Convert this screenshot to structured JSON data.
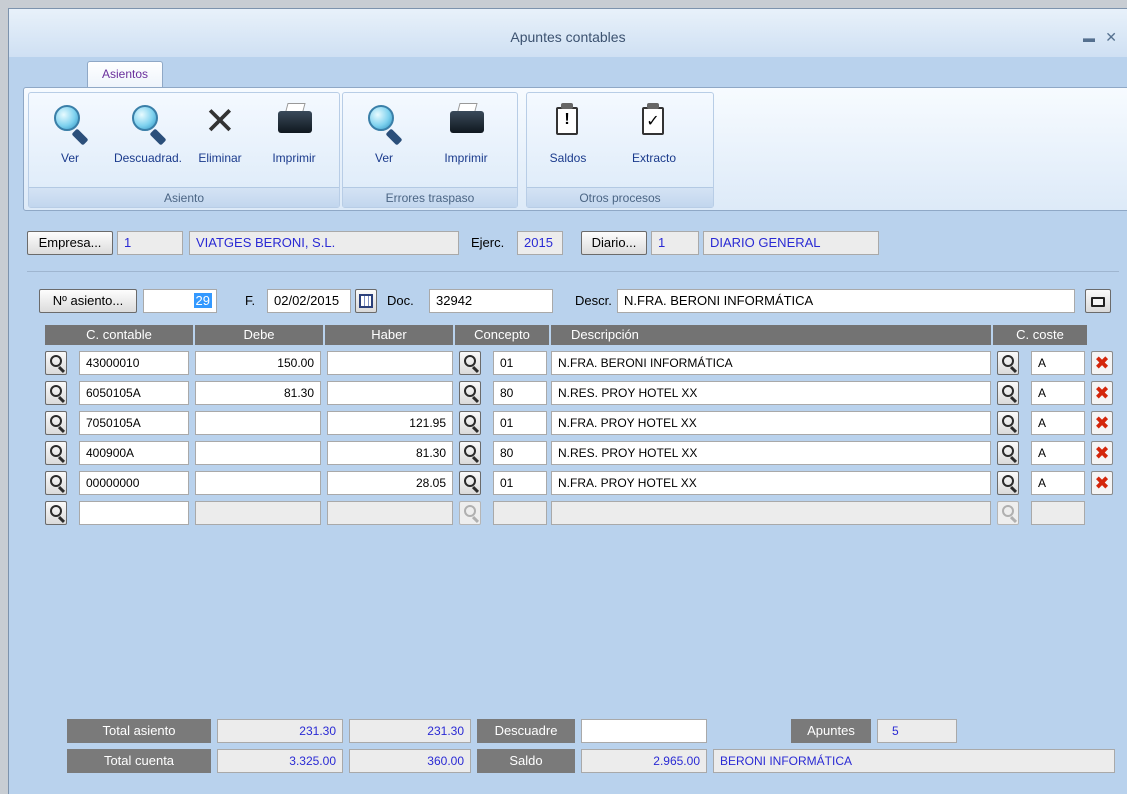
{
  "window": {
    "title": "Apuntes contables"
  },
  "tabs": [
    {
      "label": "Asientos"
    }
  ],
  "ribbon": {
    "groups": [
      {
        "label": "Asiento",
        "buttons": [
          {
            "label": "Ver",
            "icon": "magnifier-icon"
          },
          {
            "label": "Descuadrad.",
            "icon": "magnifier-icon"
          },
          {
            "label": "Eliminar",
            "icon": "delete-x-icon"
          },
          {
            "label": "Imprimir",
            "icon": "printer-icon"
          }
        ]
      },
      {
        "label": "Errores traspaso",
        "buttons": [
          {
            "label": "Ver",
            "icon": "magnifier-icon"
          },
          {
            "label": "Imprimir",
            "icon": "printer-icon"
          }
        ]
      },
      {
        "label": "Otros procesos",
        "buttons": [
          {
            "label": "Saldos",
            "icon": "clipboard-alert-icon"
          },
          {
            "label": "Extracto",
            "icon": "clipboard-check-icon"
          }
        ]
      }
    ]
  },
  "header": {
    "empresa_button": "Empresa...",
    "empresa_code": "1",
    "empresa_name": "VIATGES BERONI, S.L.",
    "ejerc_label": "Ejerc.",
    "ejerc_value": "2015",
    "diario_button": "Diario...",
    "diario_code": "1",
    "diario_name": "DIARIO GENERAL"
  },
  "asiento": {
    "button": "Nº asiento...",
    "number": "29",
    "fecha_label": "F.",
    "fecha": "02/02/2015",
    "doc_label": "Doc.",
    "doc": "32942",
    "descr_label": "Descr.",
    "descr": "N.FRA. BERONI INFORMÁTICA"
  },
  "grid": {
    "columns": [
      "C. contable",
      "Debe",
      "Haber",
      "Concepto",
      "Descripción",
      "C. coste"
    ],
    "rows": [
      {
        "cuenta": "43000010",
        "debe": "150.00",
        "haber": "",
        "concepto": "01",
        "descripcion": "N.FRA. BERONI INFORMÁTICA",
        "coste": "A"
      },
      {
        "cuenta": "6050105A",
        "debe": "81.30",
        "haber": "",
        "concepto": "80",
        "descripcion": "N.RES. PROY HOTEL XX",
        "coste": "A"
      },
      {
        "cuenta": "7050105A",
        "debe": "",
        "haber": "121.95",
        "concepto": "01",
        "descripcion": "N.FRA. PROY HOTEL XX",
        "coste": "A"
      },
      {
        "cuenta": "400900A",
        "debe": "",
        "haber": "81.30",
        "concepto": "80",
        "descripcion": "N.RES. PROY HOTEL XX",
        "coste": "A"
      },
      {
        "cuenta": "00000000",
        "debe": "",
        "haber": "28.05",
        "concepto": "01",
        "descripcion": "N.FRA. PROY HOTEL XX",
        "coste": "A"
      }
    ]
  },
  "totals": {
    "total_asiento_label": "Total asiento",
    "total_asiento_debe": "231.30",
    "total_asiento_haber": "231.30",
    "descuadre_label": "Descuadre",
    "descuadre_value": "",
    "apuntes_label": "Apuntes",
    "apuntes_value": "5",
    "total_cuenta_label": "Total cuenta",
    "total_cuenta_debe": "3.325.00",
    "total_cuenta_haber": "360.00",
    "saldo_label": "Saldo",
    "saldo_value": "2.965.00",
    "cuenta_name": "BERONI INFORMÁTICA"
  }
}
